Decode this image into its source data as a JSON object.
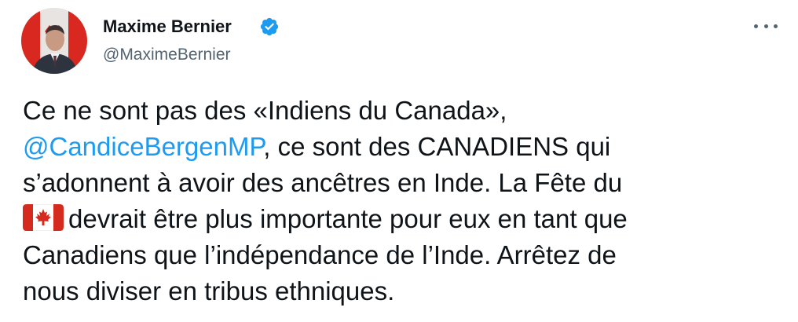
{
  "author": {
    "display_name": "Maxime Bernier",
    "handle": "@MaximeBernier",
    "verified": true
  },
  "icons": {
    "verified": "verified-badge-icon",
    "more": "more-options-icon",
    "flag": "canada-flag-emoji"
  },
  "colors": {
    "mention": "#1d9bf0",
    "verified": "#1d9bf0",
    "text": "#0f1419",
    "secondary": "#536471",
    "flag_red": "#d52b1e"
  },
  "tweet": {
    "line1": "Ce ne sont pas des «Indiens du Canada»,",
    "mention": "@CandiceBergenMP",
    "line2_rest": ", ce sont des CANADIENS qui",
    "line3": "s’adonnent à avoir des ancêtres en Inde. La Fête du",
    "line4_rest": "devrait être plus importante pour eux en tant que",
    "line5": "Canadiens que l’indépendance de l’Inde. Arrêtez de",
    "line6": "nous diviser en tribus ethniques."
  }
}
